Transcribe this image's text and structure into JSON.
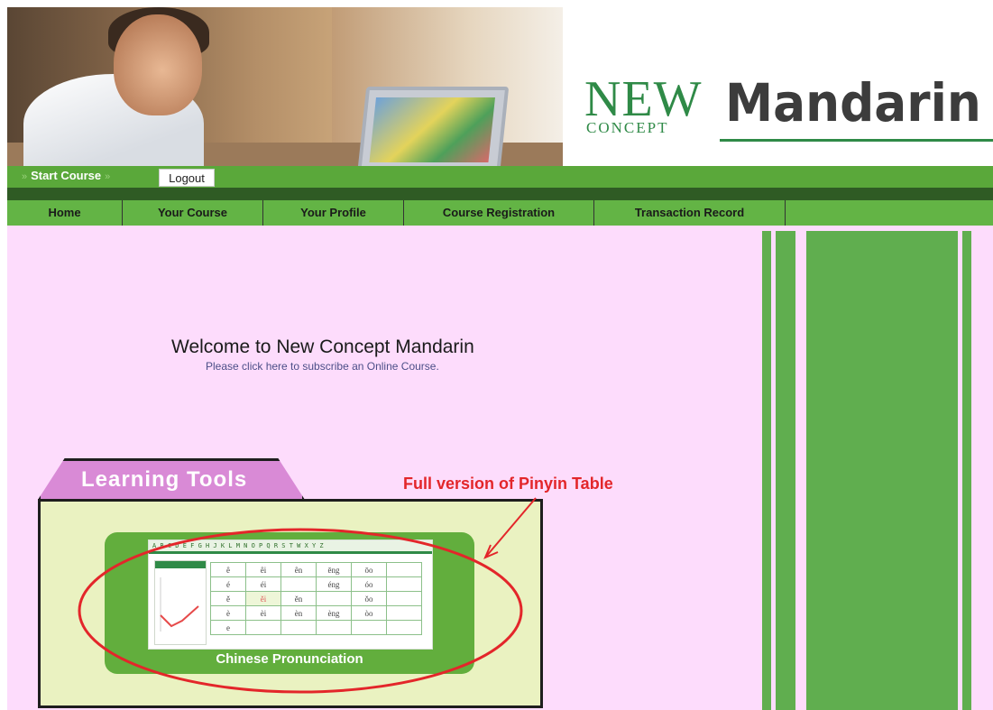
{
  "logo": {
    "new": "NEW",
    "concept": "CONCEPT",
    "mandarin": "Mandarin"
  },
  "topbar": {
    "start_course": "Start Course",
    "logout": "Logout"
  },
  "nav": [
    {
      "label": "Home"
    },
    {
      "label": "Your Course"
    },
    {
      "label": "Your Profile"
    },
    {
      "label": "Course Registration"
    },
    {
      "label": "Transaction Record"
    }
  ],
  "main": {
    "welcome": "Welcome to New Concept Mandarin",
    "subscribe": "Please click here to subscribe an Online Course."
  },
  "learning_tools": {
    "tab_label": "Learning Tools",
    "annotation": "Full version of Pinyin Table",
    "card_caption": "Chinese Pronunciation",
    "preview_letters": "A B C D E F G H J K L M N O P Q R S T W X Y Z",
    "preview_rows": [
      [
        "ê",
        "êi",
        "ên",
        "ēng",
        "ōo"
      ],
      [
        "é",
        "éi",
        "",
        "éng",
        "óo"
      ],
      [
        "ě",
        "ěi",
        "ěn",
        "",
        "ǒo"
      ],
      [
        "è",
        "èi",
        "èn",
        "èng",
        "òo"
      ],
      [
        "e",
        "",
        "",
        "",
        ""
      ]
    ]
  },
  "colors": {
    "brand_green": "#2f8a47",
    "nav_green": "#63b445",
    "page_pink": "#fddcfc",
    "annotation_red": "#e3262a"
  }
}
